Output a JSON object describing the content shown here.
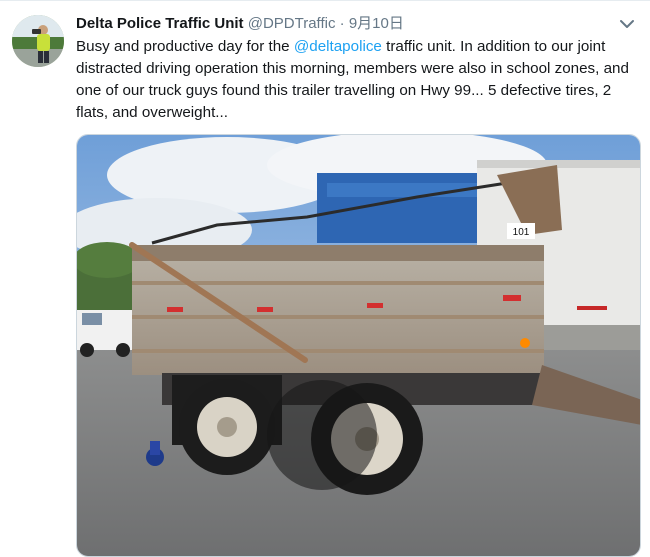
{
  "tweet": {
    "display_name": "Delta Police Traffic Unit",
    "handle": "@DPDTraffic",
    "separator": "·",
    "date": "9月10日",
    "text_before_mention": "Busy and productive day for the ",
    "mention": "@deltapolice",
    "text_after_mention": " traffic unit.   In addition to our joint distracted driving operation this morning, members were also in school zones, and one of our truck guys found this trailer travelling on Hwy 99... 5 defective tires, 2 flats, and overweight...",
    "truck_number": "101"
  },
  "icons": {
    "caret": "chevron-down-icon",
    "avatar": "profile-avatar"
  },
  "colors": {
    "link": "#1da1f2",
    "name": "#14171a",
    "meta": "#657786"
  }
}
